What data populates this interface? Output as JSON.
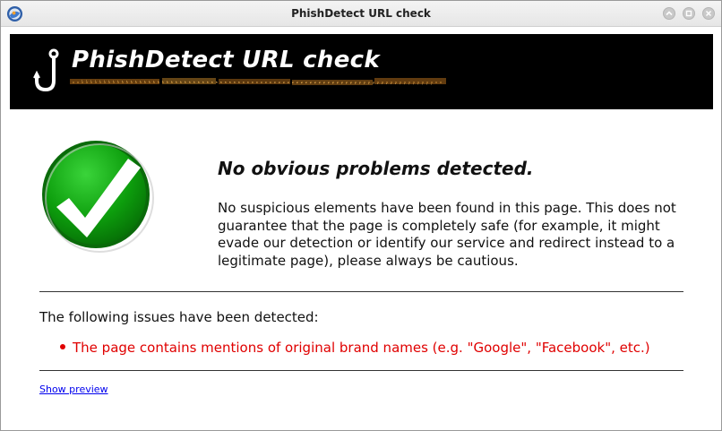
{
  "window": {
    "title": "PhishDetect URL check"
  },
  "banner": {
    "title": "PhishDetect URL check"
  },
  "result": {
    "headline": "No obvious problems detected.",
    "description": "No suspicious elements have been found in this page. This does not guarantee that the page is completely safe (for example, it might evade our detection or identify our service and redirect instead to a legitimate page), please always be cautious.",
    "icon": "green-checkmark-icon"
  },
  "issues": {
    "heading": "The following issues have been detected:",
    "items": [
      "The page contains mentions of original brand names (e.g. \"Google\", \"Facebook\", etc.)"
    ]
  },
  "links": {
    "show_preview": "Show preview"
  },
  "colors": {
    "banner_bg": "#000000",
    "issue_text": "#e00000",
    "check_green": "#0a9a0a",
    "link": "#0000ee"
  }
}
